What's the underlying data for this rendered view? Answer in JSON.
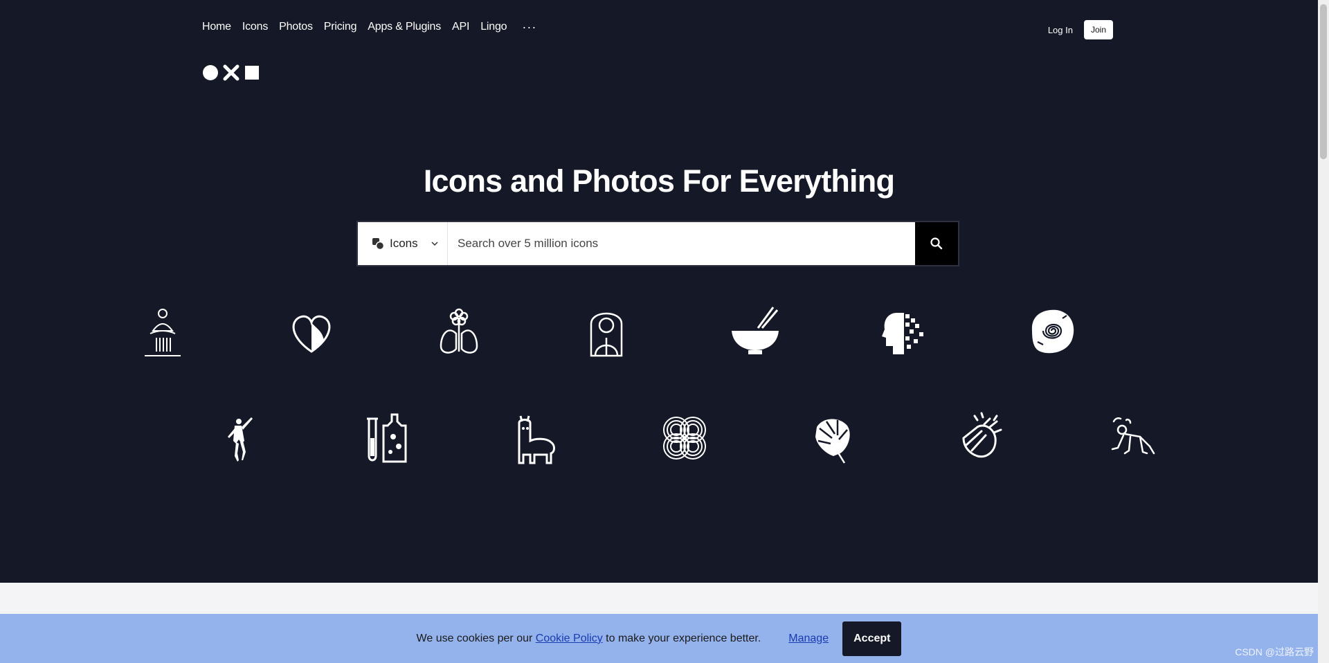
{
  "nav": {
    "items": [
      "Home",
      "Icons",
      "Photos",
      "Pricing",
      "Apps & Plugins",
      "API",
      "Lingo"
    ],
    "more": "···"
  },
  "auth": {
    "login": "Log In",
    "join": "Join"
  },
  "hero": {
    "headline": "Icons and Photos For Everything"
  },
  "search": {
    "type_label": "Icons",
    "placeholder": "Search over 5 million icons"
  },
  "icons": [
    "meditating-buddha-icon",
    "heart-face-icon",
    "flower-lungs-icon",
    "woman-portrait-icon",
    "bowl-chopsticks-icon",
    "pixel-head-icon",
    "ammonite-fossil-icon",
    "dancer-icon",
    "test-tube-bottle-icon",
    "llama-icon",
    "interlocking-circles-icon",
    "monstera-leaf-icon",
    "clapping-hands-icon",
    "push-up-person-icon"
  ],
  "cookie": {
    "text_before": "We use cookies per our ",
    "link": "Cookie Policy",
    "text_after": " to make your experience better.",
    "manage": "Manage",
    "accept": "Accept"
  },
  "watermark": "CSDN @过路云野",
  "colors": {
    "hero_bg": "#151826",
    "cookie_bg": "#94b2ec",
    "link": "#1a3bb0"
  }
}
